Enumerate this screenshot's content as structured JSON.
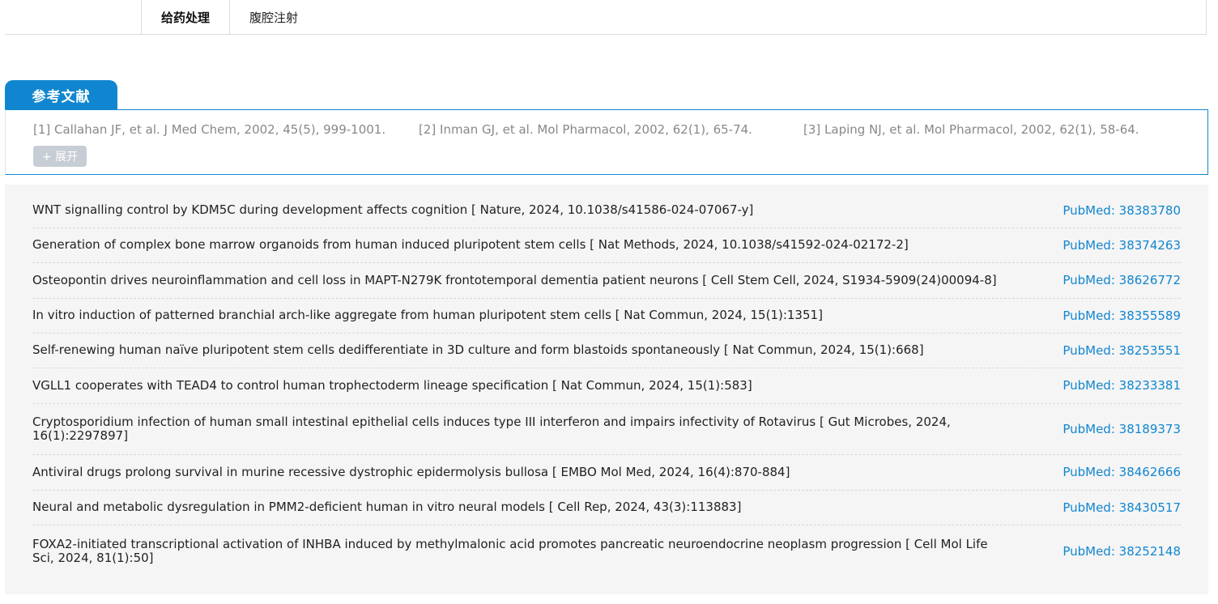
{
  "top_table": {
    "label": "给药处理",
    "value": "腹腔注射"
  },
  "references": {
    "tab_label": "参考文献",
    "items": [
      "[1] Callahan JF, et al. J Med Chem, 2002, 45(5), 999-1001.",
      "[2] Inman GJ, et al. Mol Pharmacol, 2002, 62(1), 65-74.",
      "[3] Laping NJ, et al. Mol Pharmacol, 2002, 62(1), 58-64."
    ],
    "expand_label": "+ 展开"
  },
  "citations": [
    {
      "title": "WNT signalling control by KDM5C during development affects cognition [ Nature, 2024, 10.1038/s41586-024-07067-y]",
      "pubmed": "PubMed: 38383780"
    },
    {
      "title": "Generation of complex bone marrow organoids from human induced pluripotent stem cells [ Nat Methods, 2024, 10.1038/s41592-024-02172-2]",
      "pubmed": "PubMed: 38374263"
    },
    {
      "title": "Osteopontin drives neuroinflammation and cell loss in MAPT-N279K frontotemporal dementia patient neurons [ Cell Stem Cell, 2024, S1934-5909(24)00094-8]",
      "pubmed": "PubMed: 38626772"
    },
    {
      "title": "In vitro induction of patterned branchial arch-like aggregate from human pluripotent stem cells [ Nat Commun, 2024, 15(1):1351]",
      "pubmed": "PubMed: 38355589"
    },
    {
      "title": "Self-renewing human naïve pluripotent stem cells dedifferentiate in 3D culture and form blastoids spontaneously [ Nat Commun, 2024, 15(1):668]",
      "pubmed": "PubMed: 38253551"
    },
    {
      "title": "VGLL1 cooperates with TEAD4 to control human trophectoderm lineage specification [ Nat Commun, 2024, 15(1):583]",
      "pubmed": "PubMed: 38233381"
    },
    {
      "title": "Cryptosporidium infection of human small intestinal epithelial cells induces type III interferon and impairs infectivity of Rotavirus [ Gut Microbes, 2024, 16(1):2297897]",
      "pubmed": "PubMed: 38189373"
    },
    {
      "title": "Antiviral drugs prolong survival in murine recessive dystrophic epidermolysis bullosa [ EMBO Mol Med, 2024, 16(4):870-884]",
      "pubmed": "PubMed: 38462666"
    },
    {
      "title": "Neural and metabolic dysregulation in PMM2-deficient human in vitro neural models [ Cell Rep, 2024, 43(3):113883]",
      "pubmed": "PubMed: 38430517"
    },
    {
      "title": "FOXA2-initiated transcriptional activation of INHBA induced by methylmalonic acid promotes pancreatic neuroendocrine neoplasm progression [ Cell Mol Life Sci, 2024, 81(1):50]",
      "pubmed": "PubMed: 38252148"
    }
  ],
  "colors": {
    "accent": "#1186d0",
    "panel_bg": "#f5f5f5",
    "muted_text": "#888888"
  }
}
